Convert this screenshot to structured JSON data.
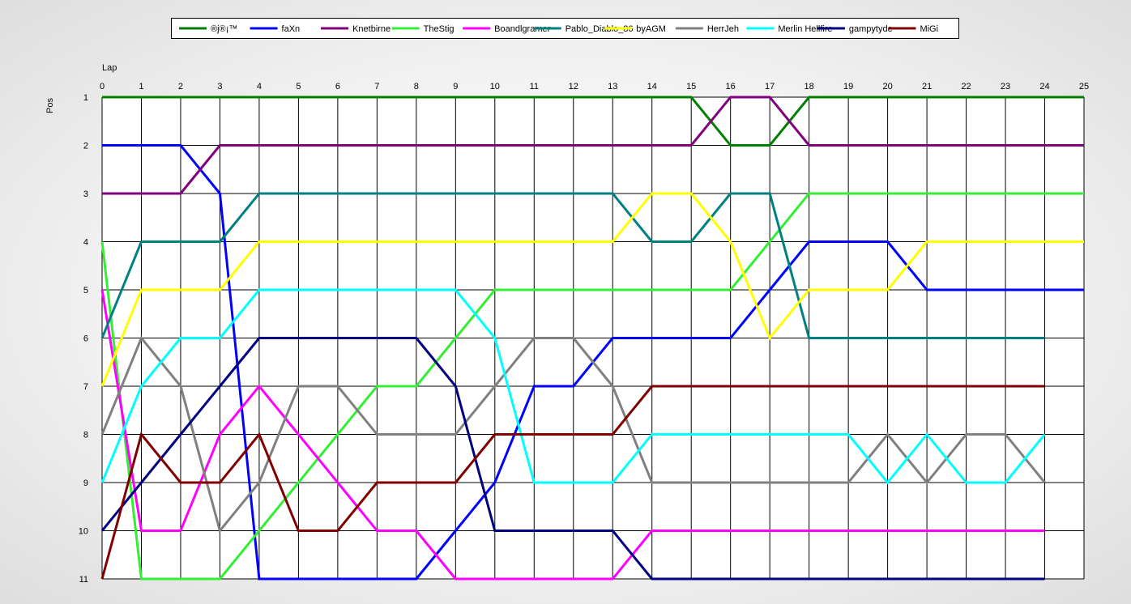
{
  "chart_data": {
    "type": "line",
    "xlabel": "Lap",
    "ylabel": "Pos",
    "xlim": [
      0,
      25
    ],
    "ylim": [
      1,
      11
    ],
    "y_inverted": true,
    "x_ticks": [
      0,
      1,
      2,
      3,
      4,
      5,
      6,
      7,
      8,
      9,
      10,
      11,
      12,
      13,
      14,
      15,
      16,
      17,
      18,
      19,
      20,
      21,
      22,
      23,
      24,
      25
    ],
    "y_ticks": [
      1,
      2,
      3,
      4,
      5,
      6,
      7,
      8,
      9,
      10,
      11
    ],
    "grid": true,
    "legend_position": "top",
    "x": [
      0,
      1,
      2,
      3,
      4,
      5,
      6,
      7,
      8,
      9,
      10,
      11,
      12,
      13,
      14,
      15,
      16,
      17,
      18,
      19,
      20,
      21,
      22,
      23,
      24,
      25
    ],
    "series": [
      {
        "name": "®j®¡™",
        "color": "#008000",
        "values": [
          1,
          1,
          1,
          1,
          1,
          1,
          1,
          1,
          1,
          1,
          1,
          1,
          1,
          1,
          1,
          1,
          2,
          2,
          1,
          1,
          1,
          1,
          1,
          1,
          1,
          1
        ]
      },
      {
        "name": "faXn",
        "color": "#0000FF",
        "values": [
          2,
          2,
          2,
          3,
          11,
          11,
          11,
          11,
          11,
          10,
          9,
          7,
          7,
          6,
          6,
          6,
          6,
          5,
          4,
          4,
          4,
          5,
          5,
          5,
          5,
          5
        ]
      },
      {
        "name": "Knetbirne",
        "color": "#800080",
        "values": [
          3,
          3,
          3,
          2,
          2,
          2,
          2,
          2,
          2,
          2,
          2,
          2,
          2,
          2,
          2,
          2,
          1,
          1,
          2,
          2,
          2,
          2,
          2,
          2,
          2,
          2
        ]
      },
      {
        "name": "TheStig",
        "color": "#33EE33",
        "values": [
          4,
          11,
          11,
          11,
          10,
          9,
          8,
          7,
          7,
          6,
          5,
          5,
          5,
          5,
          5,
          5,
          5,
          4,
          3,
          3,
          3,
          3,
          3,
          3,
          3,
          3
        ]
      },
      {
        "name": "Boandlgramer",
        "color": "#FF00FF",
        "values": [
          5,
          10,
          10,
          8,
          7,
          8,
          9,
          10,
          10,
          11,
          11,
          11,
          11,
          11,
          10,
          10,
          10,
          10,
          10,
          10,
          10,
          10,
          10,
          10,
          10
        ]
      },
      {
        "name": "Pablo_Diablo_86",
        "color": "#008080",
        "values": [
          6,
          4,
          4,
          4,
          3,
          3,
          3,
          3,
          3,
          3,
          3,
          3,
          3,
          3,
          4,
          4,
          3,
          3,
          6,
          6,
          6,
          6,
          6,
          6,
          6
        ]
      },
      {
        "name": "byAGM",
        "color": "#FFFF00",
        "values": [
          7,
          5,
          5,
          5,
          4,
          4,
          4,
          4,
          4,
          4,
          4,
          4,
          4,
          4,
          3,
          3,
          4,
          6,
          5,
          5,
          5,
          4,
          4,
          4,
          4,
          4
        ]
      },
      {
        "name": "HerrJeh",
        "color": "#808080",
        "values": [
          8,
          6,
          7,
          10,
          9,
          7,
          7,
          8,
          8,
          8,
          7,
          6,
          6,
          7,
          9,
          9,
          9,
          9,
          9,
          9,
          8,
          9,
          8,
          8,
          9
        ]
      },
      {
        "name": "Merlin Hellfire",
        "color": "#00FFFF",
        "values": [
          9,
          7,
          6,
          6,
          5,
          5,
          5,
          5,
          5,
          5,
          6,
          9,
          9,
          9,
          8,
          8,
          8,
          8,
          8,
          8,
          9,
          8,
          9,
          9,
          8
        ]
      },
      {
        "name": "gampytyde",
        "color": "#000080",
        "values": [
          10,
          9,
          8,
          7,
          6,
          6,
          6,
          6,
          6,
          7,
          10,
          10,
          10,
          10,
          11,
          11,
          11,
          11,
          11,
          11,
          11,
          11,
          11,
          11,
          11
        ]
      },
      {
        "name": "MiGi",
        "color": "#800000",
        "values": [
          11,
          8,
          9,
          9,
          8,
          10,
          10,
          9,
          9,
          9,
          8,
          8,
          8,
          8,
          7,
          7,
          7,
          7,
          7,
          7,
          7,
          7,
          7,
          7,
          7
        ]
      }
    ]
  }
}
